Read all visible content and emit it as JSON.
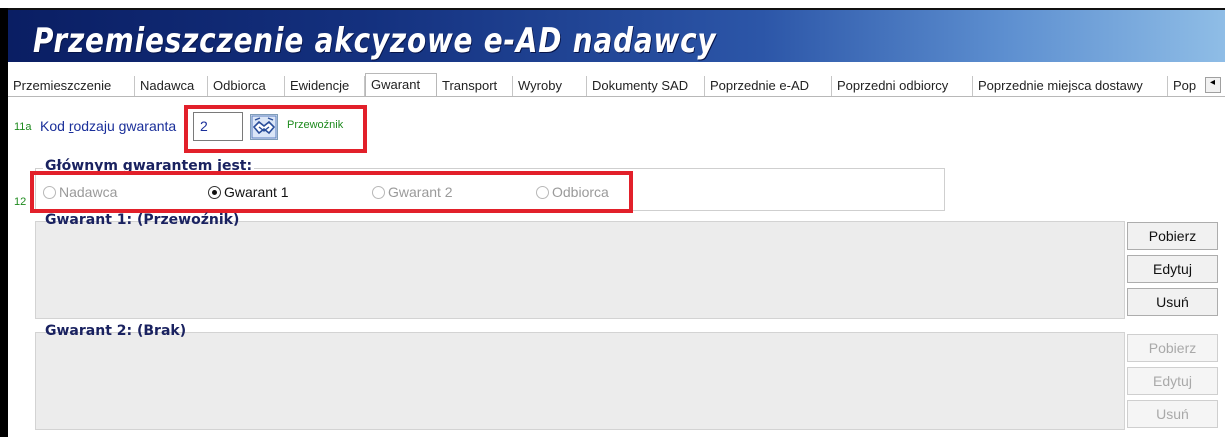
{
  "window": {
    "title": "Przemieszczenie akcyzowe e-AD nadawcy"
  },
  "tabs": [
    {
      "label": "Przemieszczenie",
      "active": false
    },
    {
      "label": "Nadawca",
      "active": false
    },
    {
      "label": "Odbiorca",
      "active": false
    },
    {
      "label": "Ewidencje",
      "active": false
    },
    {
      "label": "Gwarant",
      "active": true
    },
    {
      "label": "Transport",
      "active": false
    },
    {
      "label": "Wyroby",
      "active": false
    },
    {
      "label": "Dokumenty SAD",
      "active": false
    },
    {
      "label": "Poprzednie e-AD",
      "active": false
    },
    {
      "label": "Poprzedni odbiorcy",
      "active": false
    },
    {
      "label": "Poprzednie miejsca dostawy",
      "active": false
    },
    {
      "label": "Pop",
      "active": false
    }
  ],
  "tab_scroll_glyph": "◂",
  "guarantor_code": {
    "field_number": "11a",
    "label_prefix": "Kod ",
    "label_underlined": "r",
    "label_rest": "odzaju gwaranta",
    "value": "2",
    "lookup_icon": "handshake-icon",
    "description": "Przewoźnik"
  },
  "main_guarantor": {
    "field_number": "12",
    "title": "Głównym gwarantem jest:",
    "options": [
      {
        "label": "Nadawca",
        "selected": false,
        "enabled": false
      },
      {
        "label": "Gwarant 1",
        "selected": true,
        "enabled": true
      },
      {
        "label": "Gwarant 2",
        "selected": false,
        "enabled": false
      },
      {
        "label": "Odbiorca",
        "selected": false,
        "enabled": false
      }
    ]
  },
  "guarantor1": {
    "title": "Gwarant 1: (Przewoźnik)",
    "buttons": {
      "fetch": "Pobierz",
      "edit": "Edytuj",
      "delete": "Usuń"
    },
    "buttons_enabled": true
  },
  "guarantor2": {
    "title": "Gwarant 2: (Brak)",
    "buttons": {
      "fetch": "Pobierz",
      "edit": "Edytuj",
      "delete": "Usuń"
    },
    "buttons_enabled": false
  },
  "colors": {
    "highlight": "#e2202a",
    "label_blue": "#1a2f9a",
    "field_number_green": "#1d8a1d",
    "banner_dark": "#0a1e63"
  }
}
